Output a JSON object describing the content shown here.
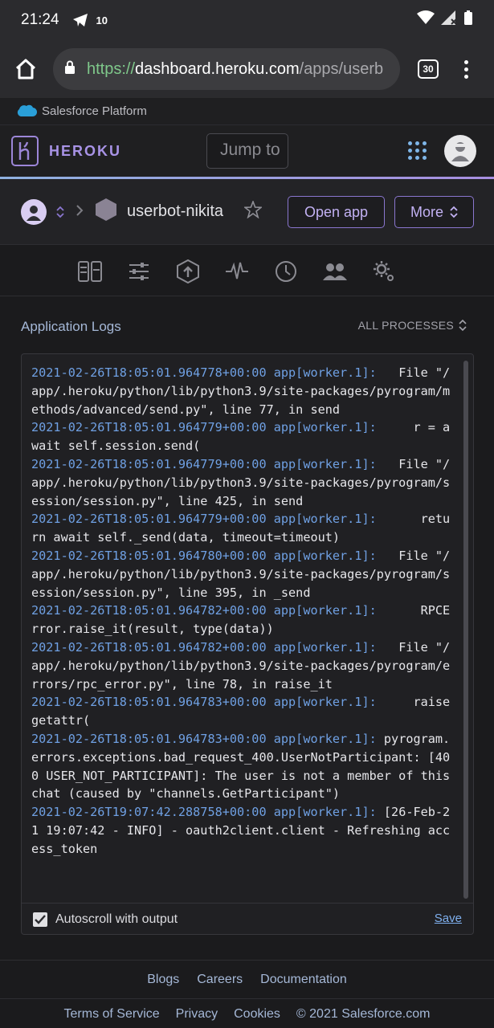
{
  "status_bar": {
    "time": "21:24",
    "notification_count": "10"
  },
  "browser": {
    "url_scheme": "https://",
    "url_host": "dashboard.heroku.com",
    "url_path": "/apps/userb",
    "tab_count": "30"
  },
  "platform": {
    "label": "Salesforce Platform"
  },
  "header": {
    "brand": "HEROKU",
    "jump_placeholder": "Jump to"
  },
  "app_bar": {
    "app_name": "userbot-nikita",
    "open_app": "Open app",
    "more": "More"
  },
  "logs": {
    "title": "Application Logs",
    "processes": "ALL PROCESSES",
    "entries": [
      {
        "time": "2021-02-26T18:05:01.964778+00:00 app[worker.1]:",
        "text": "   File \"/app/.heroku/python/lib/python3.9/site-packages/pyrogram/methods/advanced/send.py\", line 77, in send"
      },
      {
        "time": "2021-02-26T18:05:01.964779+00:00 app[worker.1]:",
        "text": "     r = await self.session.send("
      },
      {
        "time": "2021-02-26T18:05:01.964779+00:00 app[worker.1]:",
        "text": "   File \"/app/.heroku/python/lib/python3.9/site-packages/pyrogram/session/session.py\", line 425, in send"
      },
      {
        "time": "2021-02-26T18:05:01.964779+00:00 app[worker.1]:",
        "text": "      return await self._send(data, timeout=timeout)"
      },
      {
        "time": "2021-02-26T18:05:01.964780+00:00 app[worker.1]:",
        "text": "   File \"/app/.heroku/python/lib/python3.9/site-packages/pyrogram/session/session.py\", line 395, in _send"
      },
      {
        "time": "2021-02-26T18:05:01.964782+00:00 app[worker.1]:",
        "text": "      RPCError.raise_it(result, type(data))"
      },
      {
        "time": "2021-02-26T18:05:01.964782+00:00 app[worker.1]:",
        "text": "   File \"/app/.heroku/python/lib/python3.9/site-packages/pyrogram/errors/rpc_error.py\", line 78, in raise_it"
      },
      {
        "time": "2021-02-26T18:05:01.964783+00:00 app[worker.1]:",
        "text": "     raise getattr("
      },
      {
        "time": "2021-02-26T18:05:01.964783+00:00 app[worker.1]:",
        "text": " pyrogram.errors.exceptions.bad_request_400.UserNotParticipant: [400 USER_NOT_PARTICIPANT]: The user is not a member of this chat (caused by \"channels.GetParticipant\")"
      },
      {
        "time": "2021-02-26T19:07:42.288758+00:00 app[worker.1]:",
        "text": " [26-Feb-21 19:07:42 - INFO] - oauth2client.client - Refreshing access_token"
      }
    ],
    "autoscroll_label": "Autoscroll with output",
    "autoscroll_checked": true,
    "save_label": "Save"
  },
  "footer": {
    "links": [
      "Blogs",
      "Careers",
      "Documentation"
    ],
    "bottom_links": [
      "Terms of Service",
      "Privacy",
      "Cookies"
    ],
    "copyright": "© 2021 Salesforce.com"
  },
  "colors": {
    "accent": "#a893e6",
    "link": "#a5b8d7",
    "log_time": "#6fa0e3"
  }
}
